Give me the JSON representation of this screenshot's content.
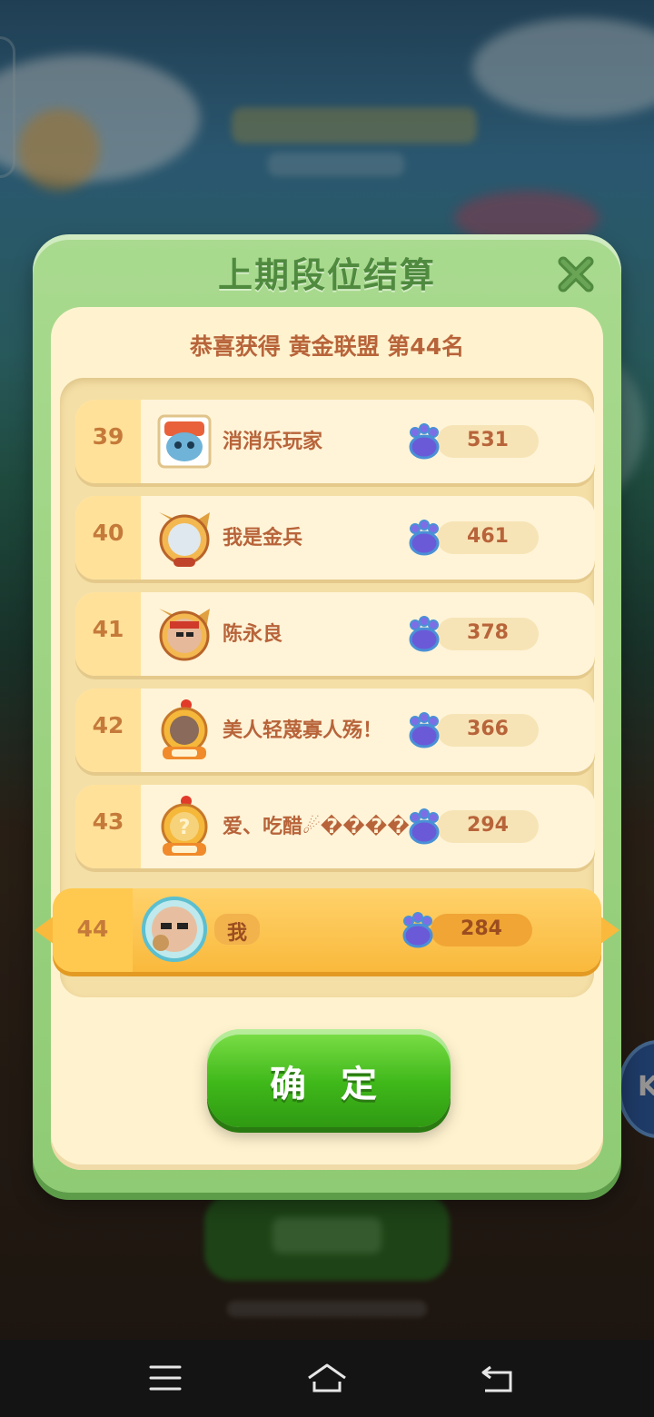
{
  "dialog": {
    "title": "上期段位结算",
    "subtitle": "恭喜获得 黄金联盟 第44名",
    "confirm_label": "确 定"
  },
  "ranking": [
    {
      "rank": "39",
      "name": "消消乐玩家",
      "score": "531",
      "avatar": "blue-blob-avatar-icon"
    },
    {
      "rank": "40",
      "name": "我是金兵",
      "score": "461",
      "avatar": "cat-frame-avatar-icon"
    },
    {
      "rank": "41",
      "name": "陈永良",
      "score": "378",
      "avatar": "cat-frame-photo-avatar-icon"
    },
    {
      "rank": "42",
      "name": "美人轻蔑寡人殇！",
      "score": "366",
      "avatar": "chicken-1000-avatar-icon"
    },
    {
      "rank": "43",
      "name": "爱、吃醋☄����",
      "score": "294",
      "avatar": "chicken-1000-avatar-icon"
    }
  ],
  "me": {
    "rank": "44",
    "name": "我",
    "score": "284"
  },
  "colors": {
    "dialog_green": "#a9da8f",
    "panel_cream": "#fff3cf",
    "text_brown": "#b8643a",
    "highlight_gold": "#f9b93c",
    "button_green": "#3fb81a"
  },
  "navbar": {
    "icons": [
      "menu-icon",
      "home-icon",
      "back-icon"
    ]
  }
}
